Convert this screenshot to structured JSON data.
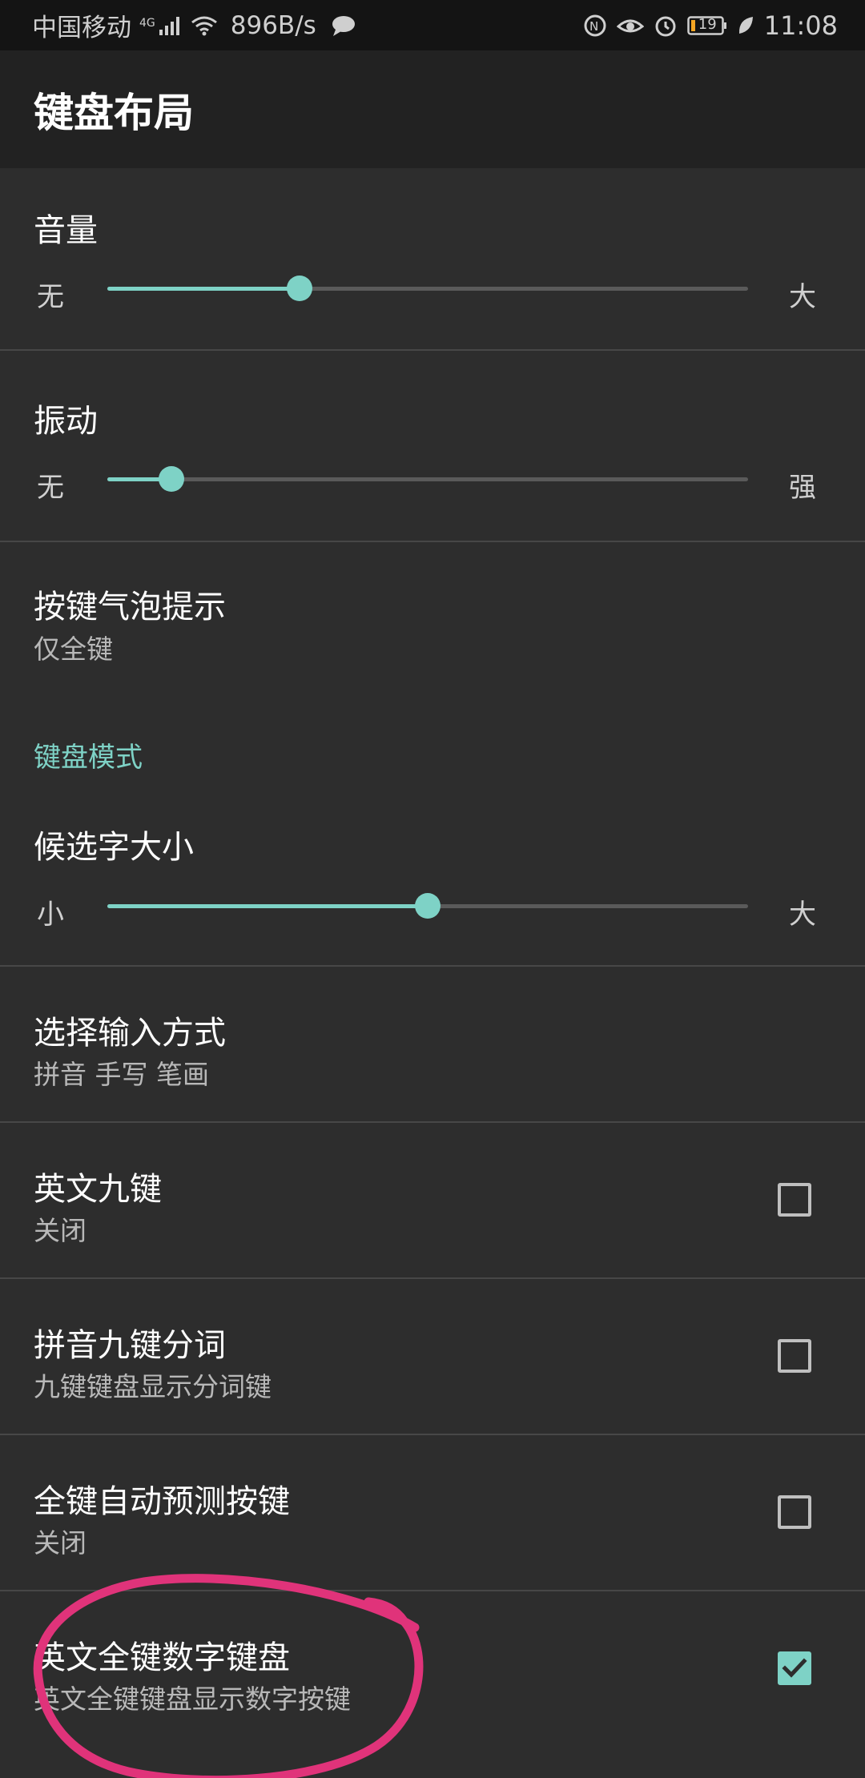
{
  "status_bar": {
    "carrier": "中国移动",
    "network": "4G",
    "speed": "896B/s",
    "battery": "19",
    "time": "11:08",
    "icons": [
      "signal-icon",
      "wifi-icon",
      "message-icon",
      "nfc-icon",
      "eye-comfort-icon",
      "alarm-icon",
      "battery-icon",
      "power-saving-leaf-icon"
    ]
  },
  "app_bar": {
    "title": "键盘布局"
  },
  "settings": {
    "volume": {
      "title": "音量",
      "min_label": "无",
      "max_label": "大",
      "value": 0.3
    },
    "vibration": {
      "title": "振动",
      "min_label": "无",
      "max_label": "强",
      "value": 0.1
    },
    "key_popup": {
      "title": "按键气泡提示",
      "summary": "仅全键"
    },
    "category_keyboard_mode": {
      "label": "键盘模式"
    },
    "candidate_size": {
      "title": "候选字大小",
      "min_label": "小",
      "max_label": "大",
      "value": 0.5
    },
    "input_method": {
      "title": "选择输入方式",
      "summary": "拼音 手写 笔画"
    },
    "english_nine_key": {
      "title": "英文九键",
      "summary": "关闭",
      "checked": false
    },
    "pinyin_nine_key_split": {
      "title": "拼音九键分词",
      "summary": "九键键盘显示分词键",
      "checked": false
    },
    "full_key_prediction": {
      "title": "全键自动预测按键",
      "summary": "关闭",
      "checked": false
    },
    "english_full_numeric": {
      "title": "英文全键数字键盘",
      "summary": "英文全键键盘显示数字按键",
      "checked": true
    }
  },
  "colors": {
    "accent": "#7ed2c6",
    "background": "#2d2d2d",
    "app_bar": "#222222",
    "status_bar": "#141414",
    "annotation": "#e0337a"
  }
}
